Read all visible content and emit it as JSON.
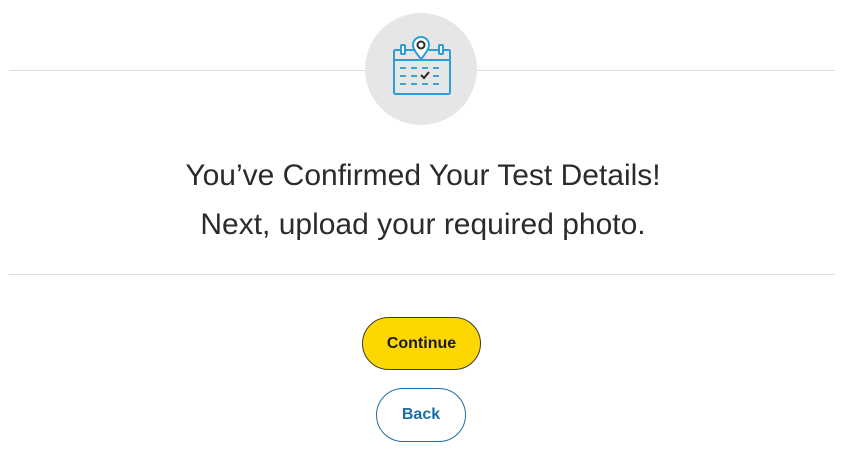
{
  "header": {
    "icon": "calendar-location-check-icon",
    "icon_color": "#2a9fd6",
    "icon_bg": "#e6e6e6"
  },
  "message": {
    "line1": "You’ve Confirmed Your Test Details!",
    "line2": "Next, upload your required photo."
  },
  "actions": {
    "continue_label": "Continue",
    "back_label": "Back",
    "continue_color": "#ffd700",
    "back_color": "#1a6ea8"
  }
}
